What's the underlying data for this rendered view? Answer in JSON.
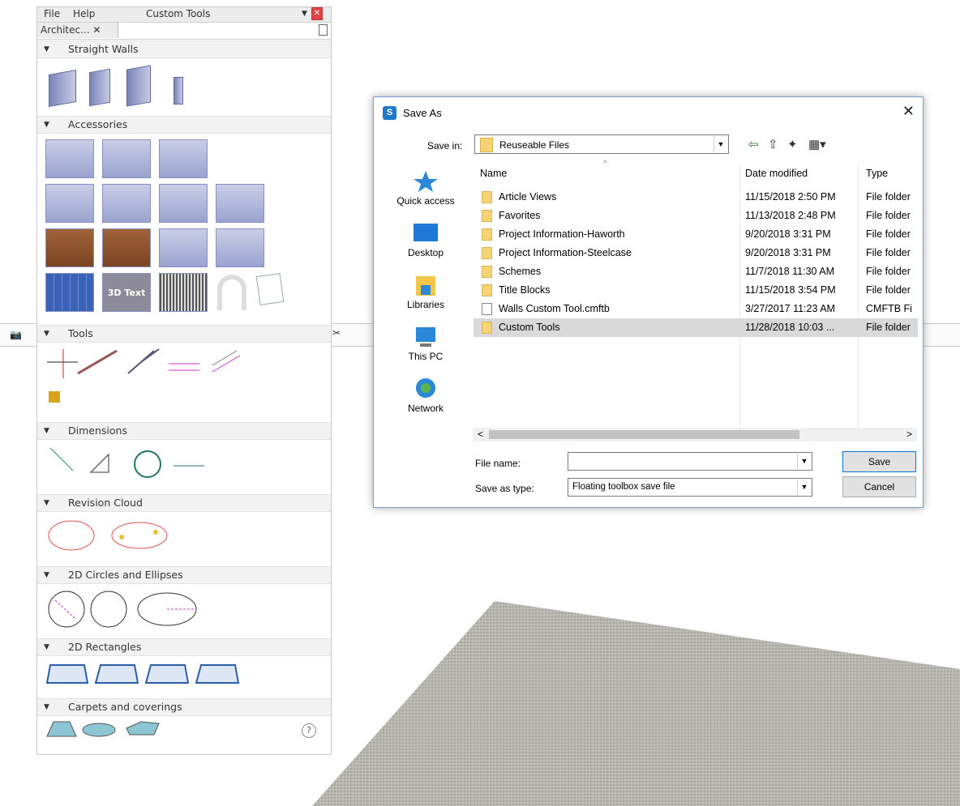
{
  "toolbox": {
    "menu": {
      "file": "File",
      "help": "Help",
      "title": "Custom Tools"
    },
    "tab_label": "Architec... ✕",
    "sections": [
      "Straight Walls",
      "Accessories",
      "Tools",
      "Dimensions",
      "Revision Cloud",
      "2D Circles and Ellipses",
      "2D Rectangles",
      "Carpets and coverings"
    ],
    "text_tool_label": "3D Text",
    "help": "?"
  },
  "dialog": {
    "title": "Save As",
    "close": "✕",
    "save_in_label": "Save in:",
    "save_in_value": "Reuseable Files",
    "places": [
      "Quick access",
      "Desktop",
      "Libraries",
      "This PC",
      "Network"
    ],
    "columns": {
      "name": "Name",
      "date": "Date modified",
      "type": "Type"
    },
    "files": [
      {
        "name": "Article Views",
        "date": "11/15/2018 2:50 PM",
        "type": "File folder"
      },
      {
        "name": "Favorites",
        "date": "11/13/2018 2:48 PM",
        "type": "File folder"
      },
      {
        "name": "Project Information-Haworth",
        "date": "9/20/2018 3:31 PM",
        "type": "File folder"
      },
      {
        "name": "Project Information-Steelcase",
        "date": "9/20/2018 3:31 PM",
        "type": "File folder"
      },
      {
        "name": "Schemes",
        "date": "11/7/2018 11:30 AM",
        "type": "File folder"
      },
      {
        "name": "Title Blocks",
        "date": "11/15/2018 3:54 PM",
        "type": "File folder"
      },
      {
        "name": "Walls Custom Tool.cmftb",
        "date": "3/27/2017 11:23 AM",
        "type": "CMFTB Fi"
      },
      {
        "name": "Custom Tools",
        "date": "11/28/2018 10:03 ...",
        "type": "File folder"
      }
    ],
    "file_name_label": "File name:",
    "file_name_value": "",
    "save_type_label": "Save as type:",
    "save_type_value": "Floating toolbox save file",
    "save_button": "Save",
    "cancel_button": "Cancel"
  },
  "colors": {
    "accent": "#0078d7",
    "folder": "#f6d475",
    "selected_row": "#d9d9d9"
  }
}
